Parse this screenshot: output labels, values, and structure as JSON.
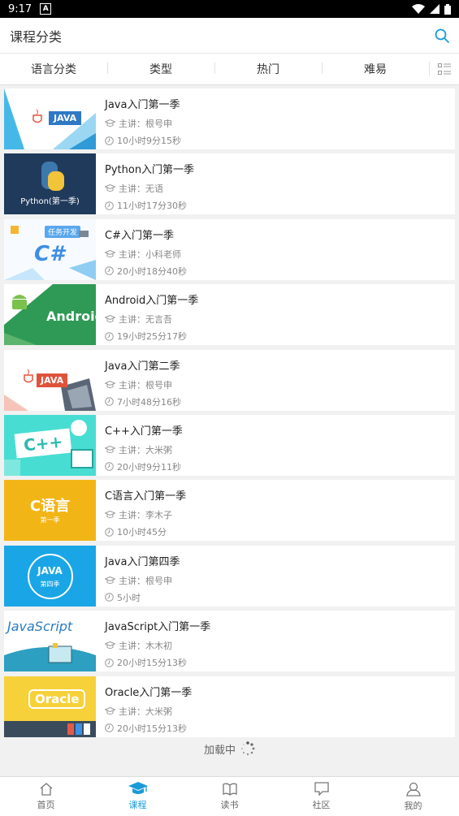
{
  "status_bar": {
    "time": "9:17",
    "notification_glyph": "A"
  },
  "header": {
    "title": "课程分类",
    "search_icon": "search-icon"
  },
  "filters": {
    "tabs": [
      "语言分类",
      "类型",
      "热门",
      "难易"
    ],
    "toggle_icon": "list-view-icon"
  },
  "courses": [
    {
      "title": "Java入门第一季",
      "teacher": "主讲：根号申",
      "duration": "10小时9分15秒",
      "thumb_label": "JAVA",
      "thumb_theme": "java1",
      "bg": "#ffffff",
      "accent": "#2f79c4"
    },
    {
      "title": "Python入门第一季",
      "teacher": "主讲：无语",
      "duration": "11小时17分30秒",
      "thumb_label": "Python(第一季)",
      "thumb_theme": "python",
      "bg": "#203a5c",
      "accent": "#f2c43a"
    },
    {
      "title": "C#入门第一季",
      "teacher": "主讲：小科老师",
      "duration": "20小时18分40秒",
      "thumb_label": "C#",
      "thumb_theme": "csharp",
      "bg": "#f7fbff",
      "accent": "#3f8fe2",
      "thumb_sub": "任务开发"
    },
    {
      "title": "Android入门第一季",
      "teacher": "主讲：无言吾",
      "duration": "19小时25分17秒",
      "thumb_label": "Android",
      "thumb_theme": "android",
      "bg": "#2e9a55",
      "accent": "#7bc24d"
    },
    {
      "title": "Java入门第二季",
      "teacher": "主讲：根号申",
      "duration": "7小时48分16秒",
      "thumb_label": "JAVA",
      "thumb_theme": "java2",
      "bg": "#ffffff",
      "accent": "#e0533b"
    },
    {
      "title": "C++入门第一季",
      "teacher": "主讲：大米粥",
      "duration": "20小时9分11秒",
      "thumb_label": "C++",
      "thumb_theme": "cpp",
      "bg": "#48ddd2",
      "accent": "#ffffff"
    },
    {
      "title": "C语言入门第一季",
      "teacher": "主讲：李木子",
      "duration": "10小时45分",
      "thumb_label": "C语言",
      "thumb_theme": "clang",
      "bg": "#f2b516",
      "accent": "#ffffff",
      "thumb_sub": "第一季"
    },
    {
      "title": "Java入门第四季",
      "teacher": "主讲：根号申",
      "duration": "5小时",
      "thumb_label": "JAVA",
      "thumb_theme": "java4",
      "bg": "#1aa6e6",
      "accent": "#ffffff",
      "thumb_sub": "第四季"
    },
    {
      "title": "JavaScript入门第一季",
      "teacher": "主讲：木木初",
      "duration": "20小时15分13秒",
      "thumb_label": "JavaScript",
      "thumb_theme": "js",
      "bg": "#ffffff",
      "accent": "#2b7bbf"
    },
    {
      "title": "Oracle入门第一季",
      "teacher": "主讲：大米粥",
      "duration": "20小时15分13秒",
      "thumb_label": "Oracle",
      "thumb_theme": "oracle",
      "bg": "#f6d13a",
      "accent": "#ffffff"
    }
  ],
  "loading": {
    "text": "加载中"
  },
  "tabbar": {
    "items": [
      {
        "label": "首页",
        "icon": "home-icon",
        "active": false
      },
      {
        "label": "课程",
        "icon": "graduation-cap-icon",
        "active": true
      },
      {
        "label": "读书",
        "icon": "book-icon",
        "active": false
      },
      {
        "label": "社区",
        "icon": "chat-bubble-icon",
        "active": false
      },
      {
        "label": "我的",
        "icon": "user-icon",
        "active": false
      }
    ]
  },
  "colors": {
    "accent": "#1a9bd8",
    "background": "#f1f1f1"
  }
}
